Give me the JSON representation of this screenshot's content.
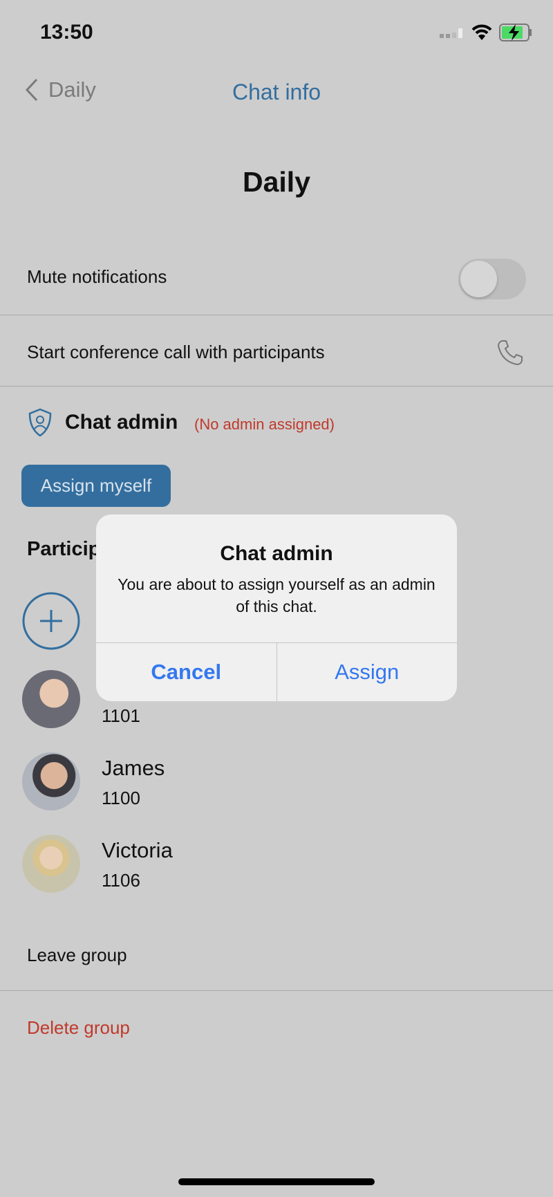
{
  "status_bar": {
    "time": "13:50",
    "battery_color": "#4cd964"
  },
  "nav": {
    "back_label": "Daily",
    "title": "Chat info"
  },
  "chat_title": "Daily",
  "settings": {
    "mute_label": "Mute notifications",
    "mute_on": false,
    "conference_label": "Start conference call with participants"
  },
  "admin": {
    "label": "Chat admin",
    "status": "(No admin assigned)",
    "assign_button": "Assign myself"
  },
  "participants": {
    "heading": "Participants",
    "items": [
      {
        "name": "",
        "number": "1101"
      },
      {
        "name": "James",
        "number": "1100"
      },
      {
        "name": "Victoria",
        "number": "1106"
      }
    ]
  },
  "actions": {
    "leave": "Leave group",
    "delete": "Delete group"
  },
  "dialog": {
    "title": "Chat admin",
    "message": "You are about to assign yourself as an admin of this chat.",
    "cancel": "Cancel",
    "confirm": "Assign"
  },
  "colors": {
    "accent": "#336e9e",
    "danger": "#c0392b",
    "alert_button": "#3478f0"
  }
}
